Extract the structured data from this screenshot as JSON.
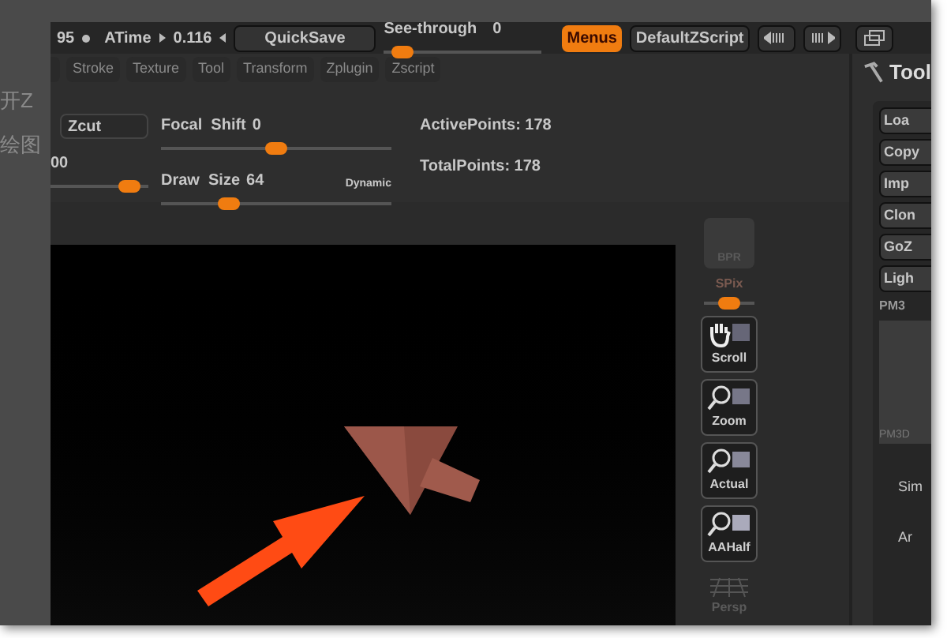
{
  "background_text": [
    "开Z",
    "绘图"
  ],
  "top_bar": {
    "fps": "95",
    "atime_label": "ATime",
    "atime_value": "0.116",
    "quicksave": "QuickSave",
    "see_through": {
      "label": "See-through",
      "value": "0",
      "level": 0.05
    },
    "buttons": [
      {
        "label": "Menus",
        "selected": true
      },
      {
        "label": "DefaultZScript",
        "selected": false
      }
    ]
  },
  "menu_tabs": [
    "Stroke",
    "Texture",
    "Tool",
    "Transform",
    "Zplugin",
    "Zscript"
  ],
  "zcut_button": "Zcut",
  "left_slider": {
    "value": "00",
    "level": 0.9
  },
  "sliders": [
    {
      "label": "Focal  Shift",
      "value": "0",
      "level": 0.5
    },
    {
      "label": "Draw  Size",
      "value": "64",
      "level": 0.27,
      "badge": "Dynamic"
    }
  ],
  "stats": [
    "ActivePoints: 178",
    "TotalPoints: 178"
  ],
  "shelf": [
    {
      "kind": "round",
      "label": "BPR",
      "disabled": true
    },
    {
      "kind": "slider",
      "label": "SPix",
      "level": 0.5,
      "disabled": true
    },
    {
      "kind": "scroll",
      "label": "Scroll",
      "disabled": false
    },
    {
      "kind": "zoom",
      "label": "Zoom",
      "disabled": false
    },
    {
      "kind": "actual",
      "label": "Actual",
      "disabled": false
    },
    {
      "kind": "aahalf",
      "label": "AAHalf",
      "disabled": false
    },
    {
      "kind": "persp",
      "label": "Persp",
      "disabled": true
    }
  ],
  "tool_palette": {
    "title": "Tool",
    "buttons": [
      "Loa",
      "Copy",
      "Imp",
      "Clon",
      "GoZ",
      "Ligh"
    ],
    "subtool_label": "PM3",
    "thumb_label": "PM3D",
    "labels": [
      "Sim",
      "Ar"
    ]
  }
}
